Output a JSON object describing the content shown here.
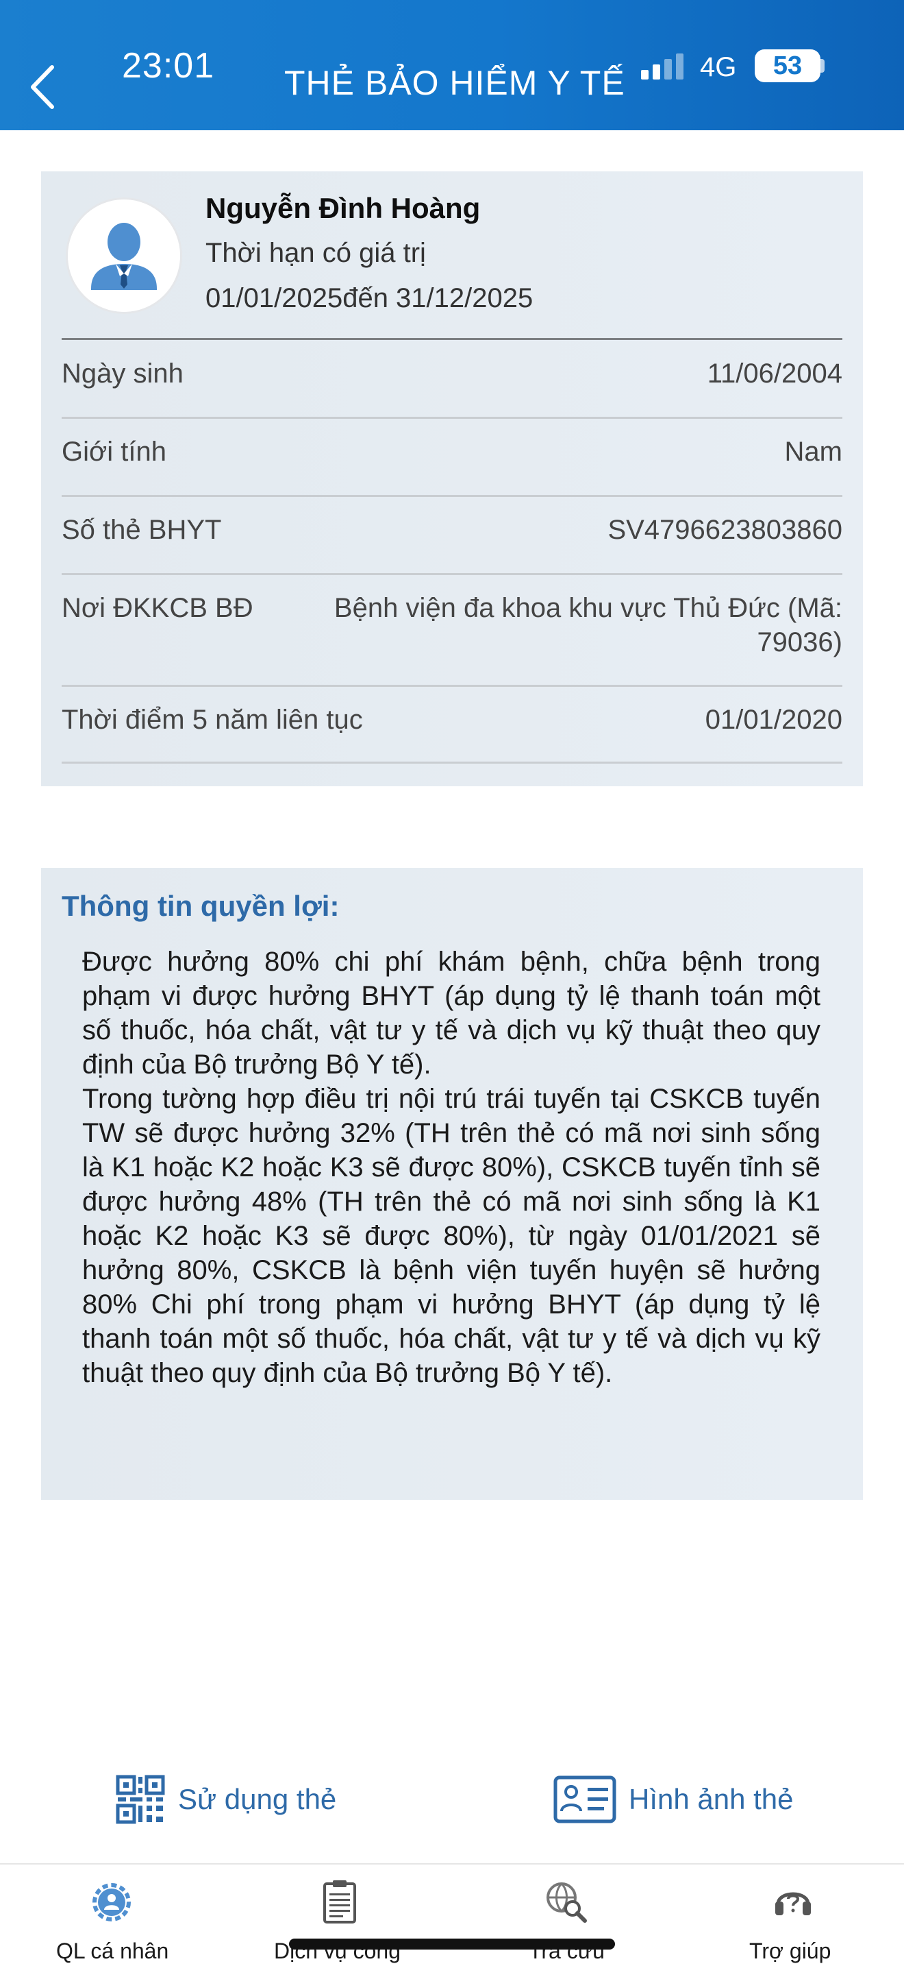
{
  "status_bar": {
    "time": "23:01",
    "network": "4G",
    "battery": "53"
  },
  "header": {
    "title": "THẺ BẢO HIỂM Y TẾ"
  },
  "card": {
    "name": "Nguyễn Đình Hoàng",
    "valid_label": "Thời hạn có giá trị",
    "valid_range": "01/01/2025đến 31/12/2025",
    "rows": [
      {
        "label": "Ngày sinh",
        "value": "11/06/2004"
      },
      {
        "label": "Giới tính",
        "value": "Nam"
      },
      {
        "label": "Số thẻ BHYT",
        "value": "SV4796623803860"
      },
      {
        "label": "Nơi ĐKKCB BĐ",
        "value_line1": "Bệnh viện đa khoa khu vực Thủ Đức (Mã:",
        "value_line2": "79036)"
      },
      {
        "label": "Thời điểm 5 năm liên tục",
        "value": "01/01/2020"
      }
    ]
  },
  "benefits": {
    "title": "Thông tin quyền lợi:",
    "paragraph1": "Được hưởng 80% chi phí khám bệnh, chữa bệnh trong phạm vi được hưởng BHYT (áp dụng tỷ lệ thanh toán một số thuốc, hóa chất, vật tư y tế và dịch vụ kỹ thuật theo quy định của Bộ trưởng Bộ Y tế).",
    "paragraph2": "Trong tường hợp điều trị nội trú trái tuyến tại CSKCB tuyến TW sẽ được hưởng 32% (TH trên thẻ có mã nơi sinh sống là K1 hoặc K2 hoặc K3 sẽ được 80%), CSKCB tuyến tỉnh sẽ được hưởng 48% (TH trên thẻ có mã nơi sinh sống là K1 hoặc K2 hoặc K3 sẽ được 80%), từ ngày 01/01/2021 sẽ hưởng 80%, CSKCB là bệnh viện tuyến huyện sẽ hưởng 80% Chi phí trong phạm vi hưởng BHYT (áp dụng tỷ lệ thanh toán một số thuốc, hóa chất, vật tư y tế và dịch vụ kỹ thuật theo quy định của Bộ trưởng Bộ Y tế)."
  },
  "actions": {
    "use_card": "Sử dụng thẻ",
    "card_image": "Hình ảnh  thẻ"
  },
  "nav": {
    "items": [
      {
        "label": "QL cá nhân",
        "icon": "gear-user-icon"
      },
      {
        "label": "Dịch vụ công",
        "icon": "document-icon"
      },
      {
        "label": "Tra cứu",
        "icon": "globe-search-icon"
      },
      {
        "label": "Trợ giúp",
        "icon": "headset-icon"
      }
    ]
  },
  "colors": {
    "header": "#1477cc",
    "accent": "#2e6aa8",
    "card_bg": "#e5ecf2"
  }
}
